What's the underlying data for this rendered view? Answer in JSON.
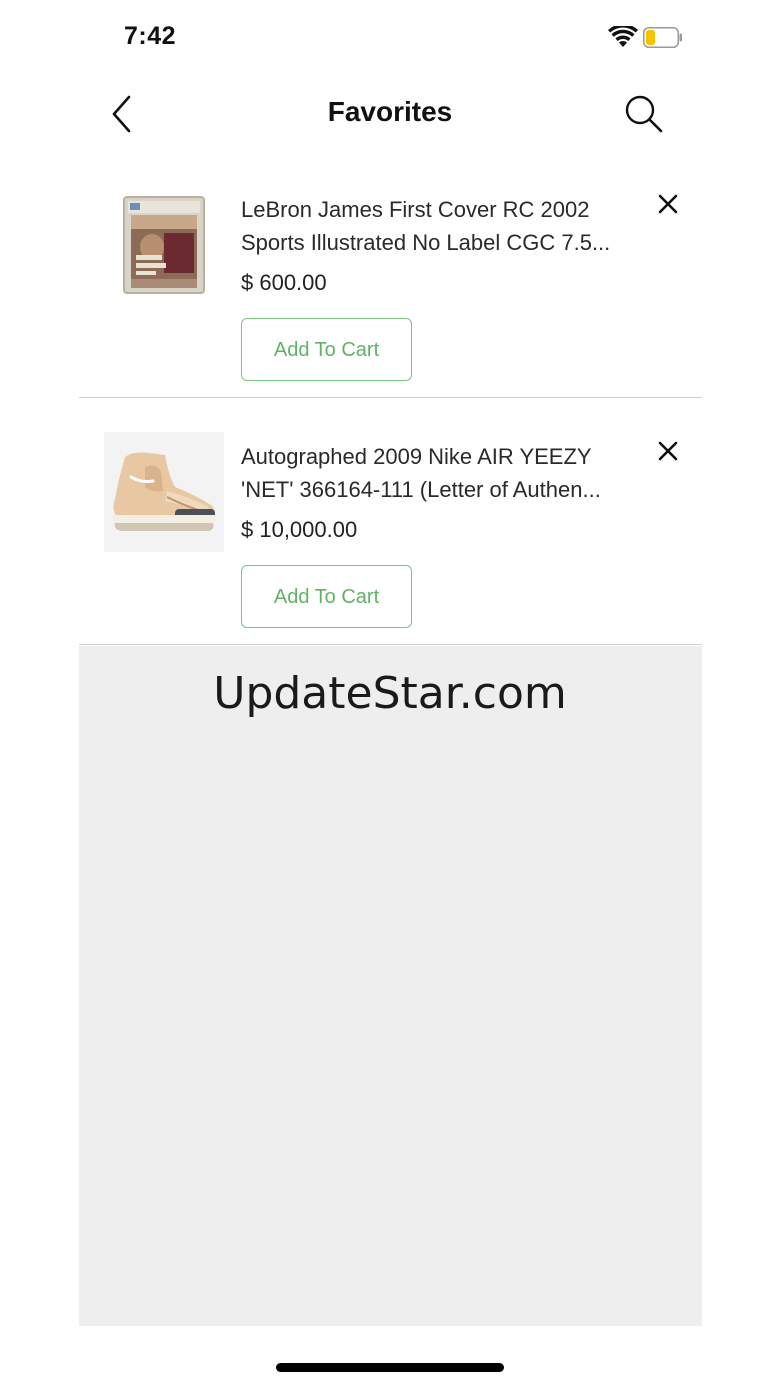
{
  "status": {
    "time": "7:42",
    "battery_color": "#f5c400"
  },
  "nav": {
    "title": "Favorites",
    "back_icon": "chevron-left-icon",
    "search_icon": "search-icon"
  },
  "items": [
    {
      "title_line1": "LeBron James First Cover RC 2002",
      "title_line2": "Sports Illustrated No Label CGC 7.5...",
      "price": "$ 600.00",
      "button_label": "Add To Cart",
      "remove_icon": "close-icon",
      "image": "magazine-cover-thumbnail"
    },
    {
      "title_line1": "Autographed 2009 Nike AIR YEEZY",
      "title_line2": "'NET' 366164-111 (Letter of Authen...",
      "price": "$ 10,000.00",
      "button_label": "Add To Cart",
      "remove_icon": "close-icon",
      "image": "sneaker-thumbnail"
    }
  ],
  "watermark": "UpdateStar.com",
  "colors": {
    "accent_green": "#5fb463",
    "empty_background": "#eeeeee"
  }
}
